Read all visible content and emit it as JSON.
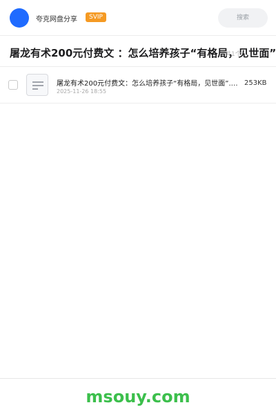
{
  "header": {
    "brand": "夸克网盘分享",
    "badge": "SVIP",
    "search_placeholder": "搜索",
    "accent_color": "#1f6bff",
    "badge_color": "#f59a23"
  },
  "share": {
    "title": "屠龙有术200元付费文 ：怎么培养孩子“有格局，见世面” ?",
    "count": "共1个"
  },
  "files": [
    {
      "name": "屠龙有术200元付费文：怎么培养孩子“有格局，见世面”.pdf",
      "date": "2025-11-26 18:55",
      "size": "253KB",
      "icon": "document-icon"
    }
  ],
  "footer": {
    "logo": "msouy.com",
    "logo_color": "#3cbf4c"
  }
}
